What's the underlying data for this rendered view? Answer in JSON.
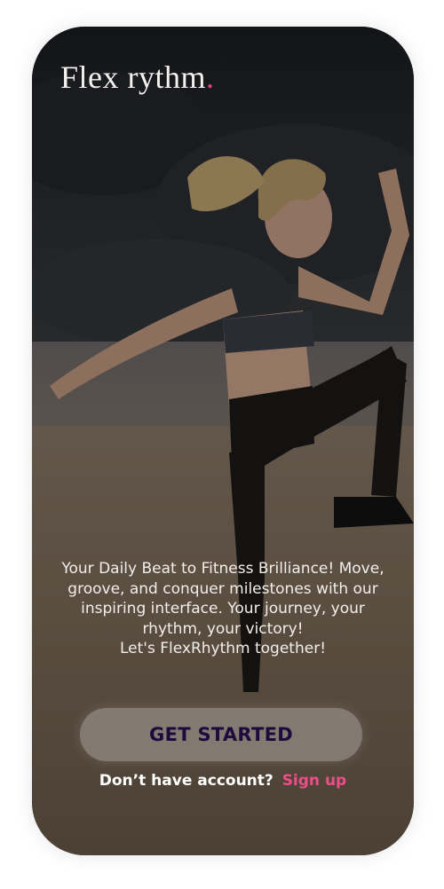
{
  "app": {
    "logo_text": "Flex rythm",
    "logo_dot": ".",
    "accent_color": "#e6407f"
  },
  "hero": {
    "tagline": "Your Daily Beat to Fitness Brilliance!  Move, groove, and conquer milestones with our inspiring interface. Your journey, your rhythm, your victory!\nLet's FlexRhythm together!"
  },
  "actions": {
    "get_started_label": "GET STARTED",
    "signup_prompt": "Don’t have account?",
    "signup_link": "Sign up"
  }
}
